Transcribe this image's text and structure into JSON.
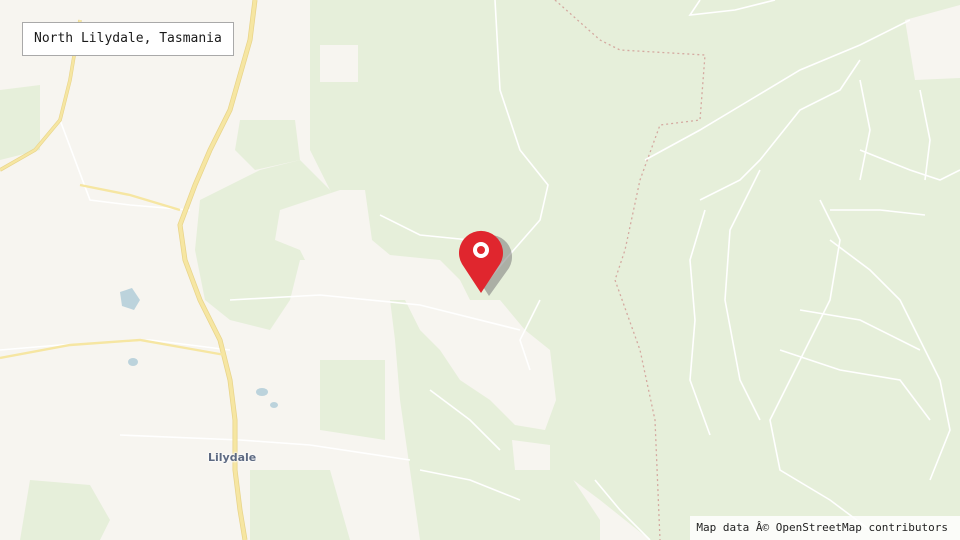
{
  "map": {
    "location_label": "North Lilydale, Tasmania",
    "town_label": "Lilydale",
    "attribution": "Map data Â© OpenStreetMap contributors",
    "marker_icon": "map-pin-icon",
    "colors": {
      "background": "#f7f5f0",
      "forest": "#e6efda",
      "forest_dark": "#d9e8c8",
      "major_road": "#f6e6a2",
      "minor_road": "#ffffff",
      "track": "#d4a9a0",
      "water": "#bcd3dc",
      "marker": "#e0262e",
      "town_label": "#5d6a82"
    }
  }
}
